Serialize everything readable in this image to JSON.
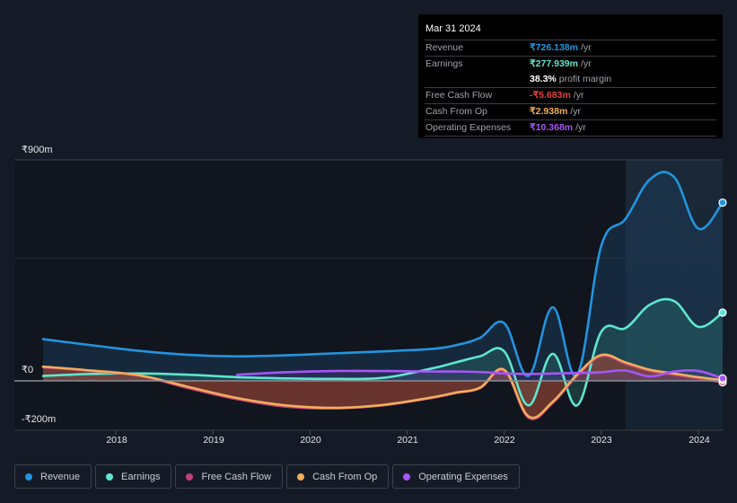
{
  "tooltip": {
    "date": "Mar 31 2024",
    "rows": [
      {
        "label": "Revenue",
        "value": "₹726.138m",
        "unit": "/yr",
        "color": "#2394df"
      },
      {
        "label": "Earnings",
        "value": "₹277.939m",
        "unit": "/yr",
        "color": "#5ee6cf"
      },
      {
        "label": "",
        "value": "38.3%",
        "unit": "profit margin",
        "color": "#ffffff"
      },
      {
        "label": "Free Cash Flow",
        "value": "-₹5.683m",
        "unit": "/yr",
        "color": "#e9403f"
      },
      {
        "label": "Cash From Op",
        "value": "₹2.938m",
        "unit": "/yr",
        "color": "#f0ad5c"
      },
      {
        "label": "Operating Expenses",
        "value": "₹10.368m",
        "unit": "/yr",
        "color": "#a855f7"
      }
    ]
  },
  "legend": [
    {
      "label": "Revenue",
      "color": "#2394df"
    },
    {
      "label": "Earnings",
      "color": "#5ee6cf"
    },
    {
      "label": "Free Cash Flow",
      "color": "#c2407a"
    },
    {
      "label": "Cash From Op",
      "color": "#f0ad5c"
    },
    {
      "label": "Operating Expenses",
      "color": "#a855f7"
    }
  ],
  "chart_data": {
    "type": "area",
    "title": "",
    "xlabel": "",
    "ylabel": "",
    "y_tick_labels": [
      "₹900m",
      "₹0",
      "-₹200m"
    ],
    "y_ticks": [
      900,
      0,
      -200
    ],
    "ylim": [
      -200,
      900
    ],
    "xlim": [
      2017.25,
      2024.25
    ],
    "x_tick_labels": [
      "2018",
      "2019",
      "2020",
      "2021",
      "2022",
      "2023",
      "2024"
    ],
    "x_ticks": [
      2018,
      2019,
      2020,
      2021,
      2022,
      2023,
      2024
    ],
    "grid": true,
    "highlight_range": [
      2023.25,
      2024.25
    ],
    "series": [
      {
        "name": "Revenue",
        "color": "#2394df",
        "x": [
          2017.25,
          2017.75,
          2018.25,
          2018.75,
          2019.25,
          2019.75,
          2020.25,
          2020.75,
          2021.25,
          2021.5,
          2021.75,
          2022.0,
          2022.25,
          2022.5,
          2022.75,
          2023.0,
          2023.25,
          2023.5,
          2023.75,
          2024.0,
          2024.25
        ],
        "y": [
          170,
          145,
          122,
          106,
          100,
          104,
          112,
          120,
          130,
          145,
          175,
          235,
          20,
          300,
          25,
          550,
          660,
          820,
          830,
          620,
          726
        ]
      },
      {
        "name": "Earnings",
        "color": "#5ee6cf",
        "x": [
          2017.25,
          2017.75,
          2018.25,
          2018.75,
          2019.25,
          2019.75,
          2020.25,
          2020.75,
          2021.25,
          2021.5,
          2021.75,
          2022.0,
          2022.25,
          2022.5,
          2022.75,
          2023.0,
          2023.25,
          2023.5,
          2023.75,
          2024.0,
          2024.25
        ],
        "y": [
          20,
          28,
          30,
          25,
          15,
          10,
          8,
          12,
          50,
          75,
          100,
          120,
          -100,
          110,
          -100,
          200,
          215,
          310,
          325,
          220,
          278
        ]
      },
      {
        "name": "Free Cash Flow",
        "color": "#c2407a",
        "x": [
          2017.25,
          2017.75,
          2018.25,
          2018.75,
          2019.25,
          2019.75,
          2020.25,
          2020.75,
          2021.25,
          2021.5,
          2021.75,
          2022.0,
          2022.25,
          2022.5,
          2022.75,
          2023.0,
          2023.25,
          2023.5,
          2023.75,
          2024.0,
          2024.25
        ],
        "y": [
          55,
          40,
          20,
          -30,
          -75,
          -105,
          -112,
          -100,
          -70,
          -50,
          -30,
          40,
          -150,
          -90,
          20,
          100,
          70,
          40,
          25,
          10,
          -6
        ]
      },
      {
        "name": "Cash From Op",
        "color": "#f0ad5c",
        "x": [
          2017.25,
          2017.75,
          2018.25,
          2018.75,
          2019.25,
          2019.75,
          2020.25,
          2020.75,
          2021.25,
          2021.5,
          2021.75,
          2022.0,
          2022.25,
          2022.5,
          2022.75,
          2023.0,
          2023.25,
          2023.5,
          2023.75,
          2024.0,
          2024.25
        ],
        "y": [
          58,
          42,
          22,
          -25,
          -70,
          -100,
          -110,
          -98,
          -68,
          -48,
          -28,
          45,
          -145,
          -85,
          25,
          105,
          75,
          45,
          30,
          15,
          3
        ]
      },
      {
        "name": "Operating Expenses",
        "color": "#a855f7",
        "x": [
          2019.25,
          2019.75,
          2020.25,
          2020.75,
          2021.25,
          2021.5,
          2021.75,
          2022.0,
          2022.25,
          2022.5,
          2022.75,
          2023.0,
          2023.25,
          2023.5,
          2023.75,
          2024.0,
          2024.25
        ],
        "y": [
          25,
          35,
          40,
          40,
          38,
          38,
          36,
          30,
          28,
          30,
          32,
          35,
          42,
          18,
          38,
          40,
          10
        ]
      }
    ]
  }
}
